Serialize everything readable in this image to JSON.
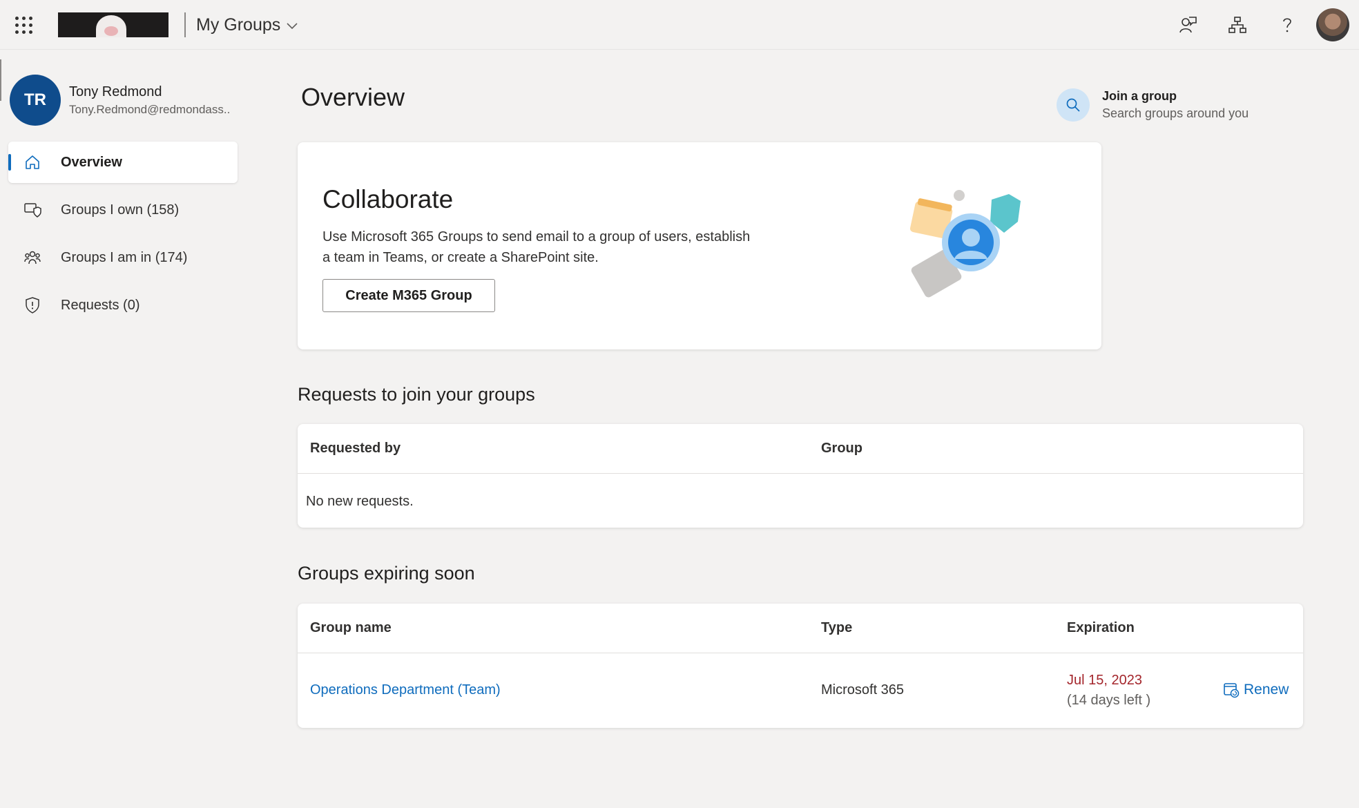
{
  "header": {
    "app_title": "My Groups",
    "icons": [
      "app-launcher-icon",
      "feedback-icon",
      "org-chart-icon",
      "help-icon"
    ]
  },
  "profile": {
    "initials": "TR",
    "name": "Tony Redmond",
    "email": "Tony.Redmond@redmondass.."
  },
  "nav": {
    "items": [
      {
        "label": "Overview",
        "icon": "home-icon",
        "active": true
      },
      {
        "label": "Groups I own (158)",
        "icon": "owner-shield-icon"
      },
      {
        "label": "Groups I am in (174)",
        "icon": "people-group-icon"
      },
      {
        "label": "Requests (0)",
        "icon": "shield-alert-icon"
      }
    ]
  },
  "main": {
    "title": "Overview",
    "join": {
      "title": "Join a group",
      "subtitle": "Search groups around you"
    },
    "collaborate": {
      "title": "Collaborate",
      "text": "Use Microsoft 365 Groups to send email to a group of users, establish a team in Teams, or create a SharePoint site.",
      "button": "Create M365 Group"
    },
    "requests": {
      "title": "Requests to join your groups",
      "columns": [
        "Requested by",
        "Group"
      ],
      "empty": "No new requests."
    },
    "expiring": {
      "title": "Groups expiring soon",
      "columns": [
        "Group name",
        "Type",
        "Expiration"
      ],
      "rows": [
        {
          "name": "Operations Department (Team)",
          "type": "Microsoft 365",
          "date": "Jul 15, 2023",
          "left": "(14 days left )",
          "action": "Renew"
        }
      ]
    }
  },
  "colors": {
    "accent": "#0f6cbd",
    "avatar": "#0f4c8c",
    "expiry": "#a4262c"
  }
}
